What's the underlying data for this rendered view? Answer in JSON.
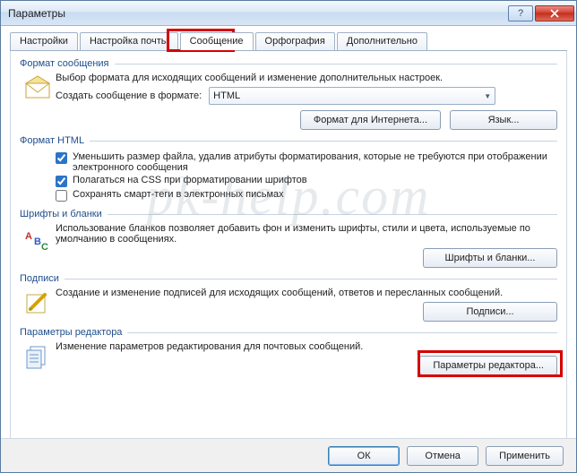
{
  "window": {
    "title": "Параметры"
  },
  "tabs": {
    "t0": "Настройки",
    "t1": "Настройка почты",
    "t2": "Сообщение",
    "t3": "Орфография",
    "t4": "Дополнительно"
  },
  "groups": {
    "format": {
      "title": "Формат сообщения",
      "desc": "Выбор формата для исходящих сообщений и изменение дополнительных настроек.",
      "compose_label": "Создать сообщение в формате:",
      "compose_value": "HTML",
      "btn_internet": "Формат для Интернета...",
      "btn_lang": "Язык..."
    },
    "html": {
      "title": "Формат HTML",
      "chk1": "Уменьшить размер файла, удалив атрибуты форматирования, которые не требуются при отображении электронного сообщения",
      "chk2": "Полагаться на CSS при форматировании шрифтов",
      "chk3": "Сохранять смарт-теги в электронных письмах"
    },
    "fonts": {
      "title": "Шрифты и бланки",
      "desc": "Использование бланков позволяет добавить фон и изменить шрифты, стили и цвета, используемые по умолчанию в сообщениях.",
      "btn": "Шрифты и бланки..."
    },
    "sign": {
      "title": "Подписи",
      "desc": "Создание и изменение подписей для исходящих сообщений, ответов и пересланных сообщений.",
      "btn": "Подписи..."
    },
    "editor": {
      "title": "Параметры редактора",
      "desc": "Изменение параметров редактирования для почтовых сообщений.",
      "btn": "Параметры редактора..."
    }
  },
  "footer": {
    "ok": "ОК",
    "cancel": "Отмена",
    "apply": "Применить"
  },
  "watermark": "pk-help.com"
}
